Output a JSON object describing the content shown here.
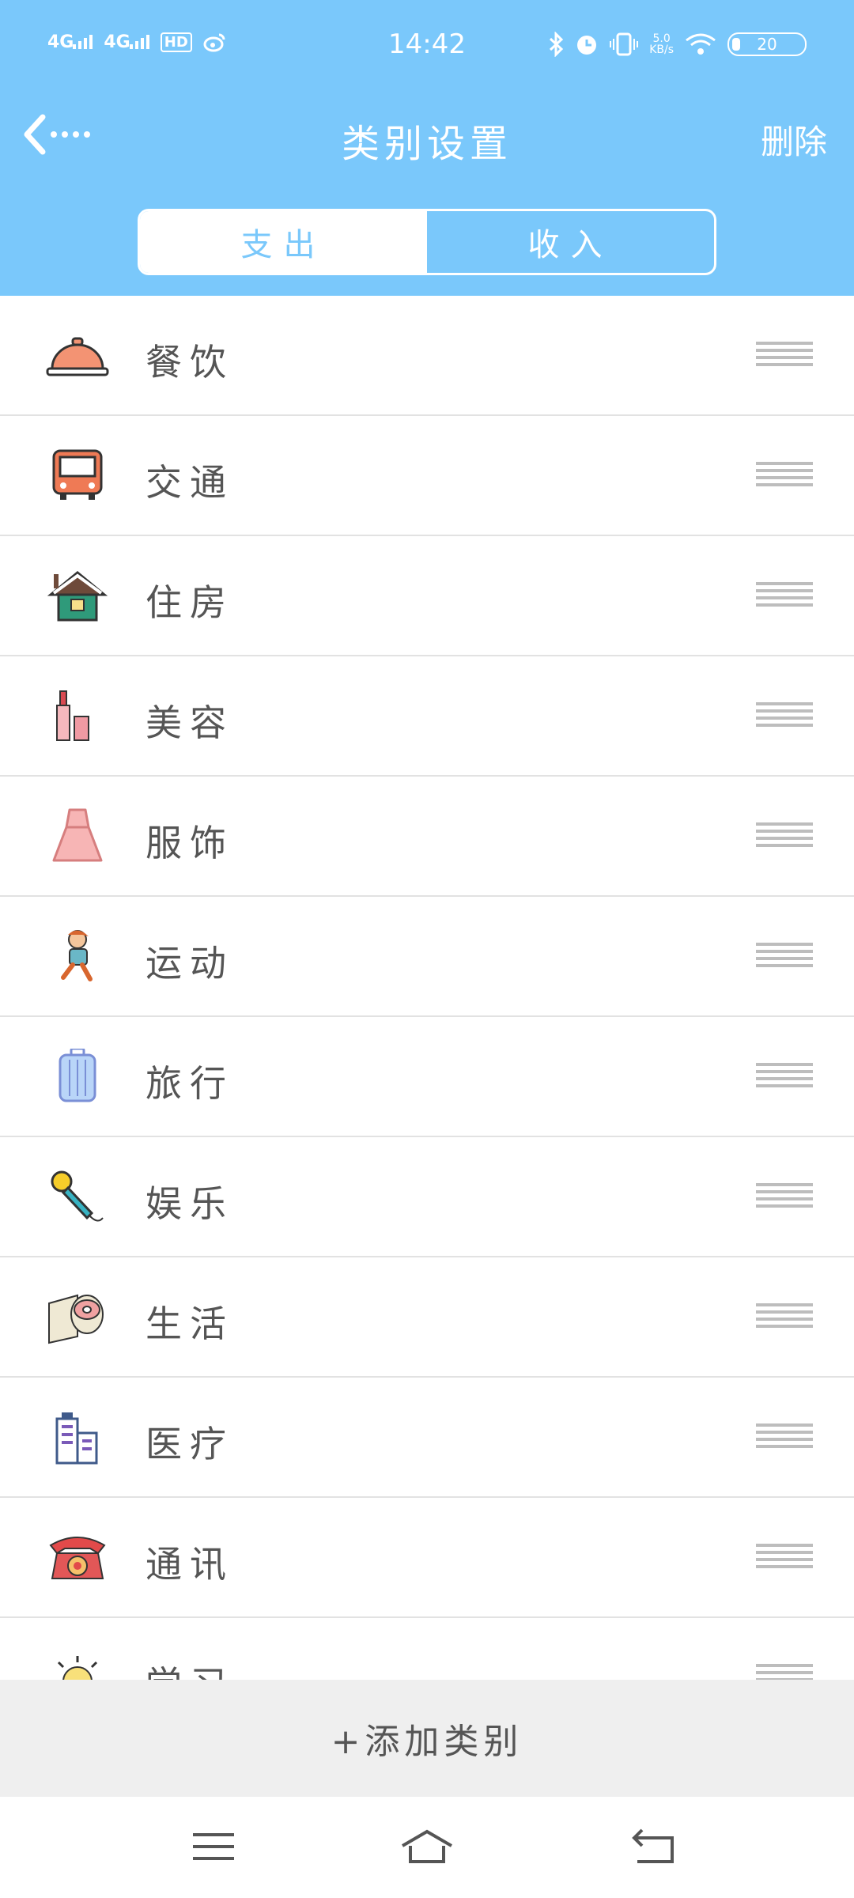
{
  "status_bar": {
    "signal1": "4G",
    "signal2": "4G",
    "hd": "HD",
    "time": "14:42",
    "net_speed_top": "5.0",
    "net_speed_bottom": "KB/s",
    "battery": "20"
  },
  "header": {
    "title": "类别设置",
    "delete_label": "删除",
    "back_icon": "back-arrow-icon"
  },
  "tabs": {
    "expense": "支出",
    "income": "收入",
    "active": "expense"
  },
  "categories": [
    {
      "label": "餐饮",
      "icon": "food-cloche-icon"
    },
    {
      "label": "交通",
      "icon": "bus-icon"
    },
    {
      "label": "住房",
      "icon": "house-icon"
    },
    {
      "label": "美容",
      "icon": "lipstick-icon"
    },
    {
      "label": "服饰",
      "icon": "dress-icon"
    },
    {
      "label": "运动",
      "icon": "running-boy-icon"
    },
    {
      "label": "旅行",
      "icon": "suitcase-icon"
    },
    {
      "label": "娱乐",
      "icon": "microphone-icon"
    },
    {
      "label": "生活",
      "icon": "toilet-paper-icon"
    },
    {
      "label": "医疗",
      "icon": "hospital-building-icon"
    },
    {
      "label": "通讯",
      "icon": "telephone-icon"
    },
    {
      "label": "学习",
      "icon": "sun-icon"
    }
  ],
  "add_category_label": "+添加类别",
  "colors": {
    "header_bg": "#7ac8fb",
    "add_bar_bg": "#efefef",
    "divider": "#e2e2e2"
  }
}
